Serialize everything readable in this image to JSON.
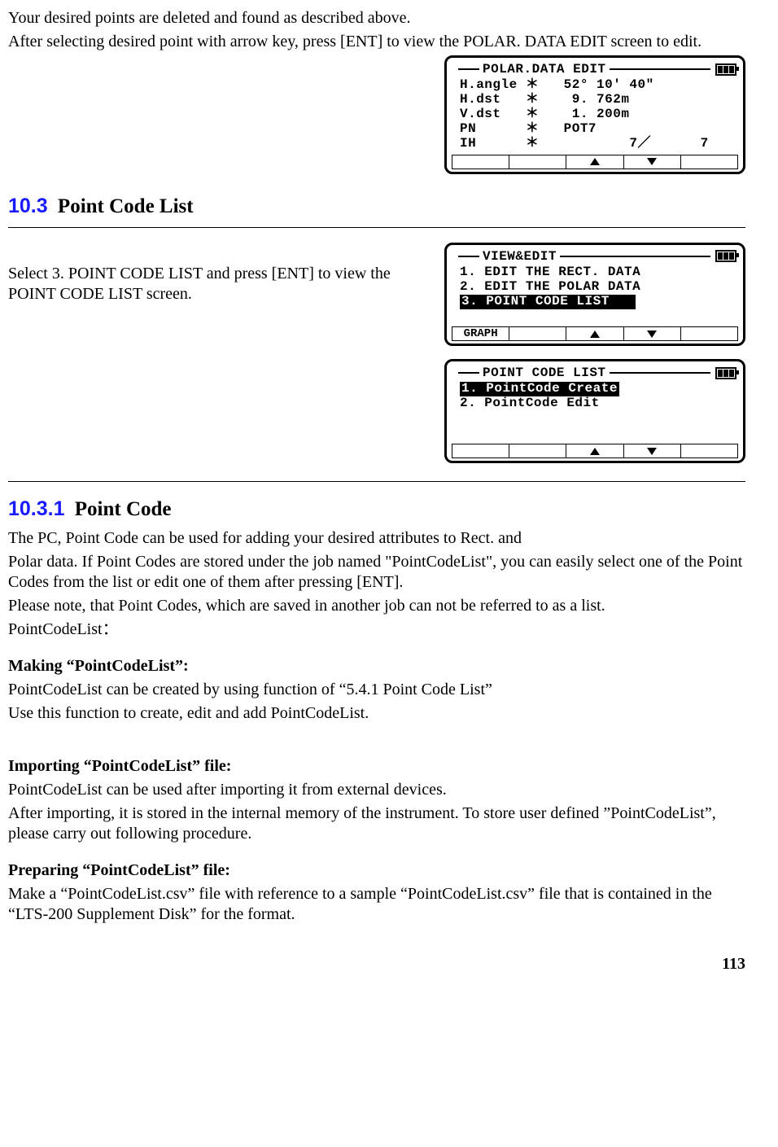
{
  "intro": {
    "line1": "Your desired points are deleted and found as described above.",
    "line2": "After selecting desired point with arrow key, press [ENT] to view the POLAR. DATA EDIT screen to edit."
  },
  "polar_screen": {
    "title": "POLAR.DATA EDIT",
    "rows": [
      "H.angle ＊   52° 10′ 40″",
      "H.dst   ＊    9. 762m",
      "V.dst   ＊    1. 200m",
      "PN      ＊   POT7",
      "IH      ＊           7／      7"
    ]
  },
  "section103": {
    "num": "10.3",
    "title": "Point Code List",
    "text": "Select 3. POINT CODE LIST and press [ENT] to view the POINT CODE LIST screen."
  },
  "view_edit_screen": {
    "title": "VIEW&EDIT",
    "items": [
      "1. EDIT THE RECT. DATA",
      "2. EDIT THE POLAR DATA",
      "3. POINT CODE LIST   "
    ],
    "selected_index": 2,
    "left_soft": "GRAPH"
  },
  "pcl_screen": {
    "title": "POINT CODE LIST",
    "items": [
      "1. PointCode Create",
      "2. PointCode Edit"
    ],
    "selected_index": 0
  },
  "section1031": {
    "num": "10.3.1",
    "title": "Point Code",
    "para1a": "The PC, Point Code can be used for adding your desired attributes to Rect. and",
    "para1b": "Polar data. If Point Codes are stored under the job named \"PointCodeList\", you can easily select one of the Point Codes from the list or edit one of them after pressing [ENT].",
    "para1c": "Please note, that Point Codes, which are saved in another job can not be referred to as a list.",
    "para1d": "PointCodeList：",
    "h_make": "Making “PointCodeList”:",
    "make1": "PointCodeList can be created by using function of “5.4.1 Point Code List”",
    "make2": "Use this function to create, edit and add PointCodeList.",
    "h_import": "Importing “PointCodeList” file:",
    "import1": "PointCodeList can be used after importing it from external devices.",
    "import2": "After importing, it is stored in the internal memory of the instrument. To store user defined ”PointCodeList”, please carry out following procedure.",
    "h_prep": "Preparing “PointCodeList” file:",
    "prep1": "Make a “PointCodeList.csv” file with reference to a sample “PointCodeList.csv” file that is contained in the “LTS-200 Supplement Disk” for the format."
  },
  "page_number": "113"
}
